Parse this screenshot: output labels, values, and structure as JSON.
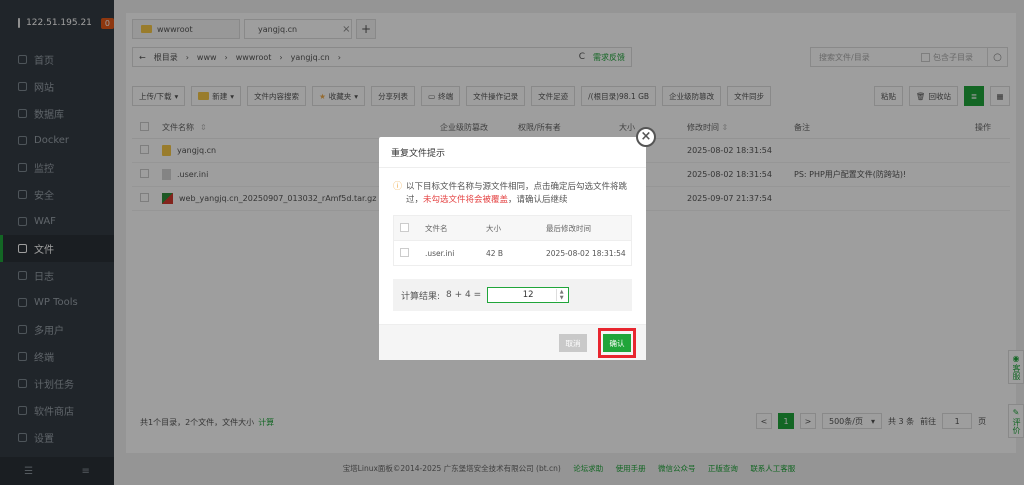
{
  "sidebar": {
    "server_ip": "122.51.195.21",
    "badge": "0",
    "items": [
      {
        "label": "首页",
        "icon": "home-icon"
      },
      {
        "label": "网站",
        "icon": "globe-icon"
      },
      {
        "label": "数据库",
        "icon": "database-icon"
      },
      {
        "label": "Docker",
        "icon": "docker-icon"
      },
      {
        "label": "监控",
        "icon": "monitor-icon"
      },
      {
        "label": "安全",
        "icon": "shield-icon"
      },
      {
        "label": "WAF",
        "icon": "waf-icon"
      },
      {
        "label": "文件",
        "icon": "folder-icon",
        "active": true
      },
      {
        "label": "日志",
        "icon": "log-icon"
      },
      {
        "label": "WP Tools",
        "icon": "wordpress-icon"
      },
      {
        "label": "多用户",
        "icon": "users-icon"
      },
      {
        "label": "终端",
        "icon": "terminal-icon"
      },
      {
        "label": "计划任务",
        "icon": "calendar-icon"
      },
      {
        "label": "软件商店",
        "icon": "store-icon"
      },
      {
        "label": "设置",
        "icon": "gear-icon"
      }
    ]
  },
  "tabs": [
    {
      "label": "wwwroot"
    },
    {
      "label": "yangjq.cn",
      "active": true
    }
  ],
  "path": {
    "back": "←",
    "segments": [
      "根目录",
      "www",
      "wwwroot",
      "yangjq.cn"
    ],
    "refresh": "C",
    "feedback": "需求反馈"
  },
  "search": {
    "placeholder": "搜索文件/目录",
    "include_sub": "包含子目录"
  },
  "toolbar": {
    "upload": "上传/下载",
    "new": "新建",
    "content_search": "文件内容搜索",
    "favorites": "收藏夹",
    "share_list": "分享列表",
    "terminal": "终端",
    "op_log": "文件操作记录",
    "footprint": "文件足迹",
    "disk": "/(根目录)98.1 GB",
    "tamper": "企业级防篡改",
    "sync": "文件同步",
    "paste": "粘贴",
    "recycle": "回收站"
  },
  "table": {
    "headers": {
      "name": "文件名称",
      "protect": "企业级防篡改",
      "perm": "权限/所有者",
      "size": "大小",
      "mtime": "修改时间",
      "note": "备注",
      "op": "操作"
    },
    "rows": [
      {
        "name": "yangjq.cn",
        "type": "folder",
        "mtime": "2025-08-02 18:31:54",
        "note": ""
      },
      {
        "name": ".user.ini",
        "type": "file",
        "mtime": "2025-08-02 18:31:54",
        "note": "PS: PHP用户配置文件(防跨站)!"
      },
      {
        "name": "web_yangjq.cn_20250907_013032_rAmf5d.tar.gz",
        "type": "archive",
        "mtime": "2025-09-07 21:37:54",
        "note": ""
      }
    ]
  },
  "summary": {
    "text": "共1个目录，2个文件，文件大小",
    "calc": "计算"
  },
  "pager": {
    "prev": "<",
    "current": "1",
    "next": ">",
    "per_page": "500条/页",
    "total": "共 3 条",
    "goto": "前往",
    "goto_value": "1",
    "page_suffix": "页"
  },
  "footer": {
    "copyright": "宝塔Linux面板©2014-2025 广东堡塔安全技术有限公司 (bt.cn)",
    "links": [
      "论坛求助",
      "使用手册",
      "微信公众号",
      "正版查询",
      "联系人工客服"
    ]
  },
  "side_float": {
    "service": "客服",
    "review": "评价"
  },
  "dialog": {
    "title": "重复文件提示",
    "close": "×",
    "message_1": "以下目标文件名称与源文件相同，点击确定后勾选文件将跳过，",
    "message_red": "未勾选文件将会被覆盖",
    "message_2": "，请确认后继续",
    "table_headers": {
      "name": "文件名",
      "size": "大小",
      "mtime": "最后修改时间"
    },
    "rows": [
      {
        "name": ".user.ini",
        "size": "42 B",
        "mtime": "2025-08-02 18:31:54"
      }
    ],
    "calc_label": "计算结果:",
    "calc_expr": "8 + 4 =",
    "calc_value": "12",
    "cancel": "取消",
    "confirm": "确认"
  },
  "colors": {
    "accent": "#20a53a",
    "sidebar_bg": "#353c44",
    "highlight": "#e8262f"
  }
}
